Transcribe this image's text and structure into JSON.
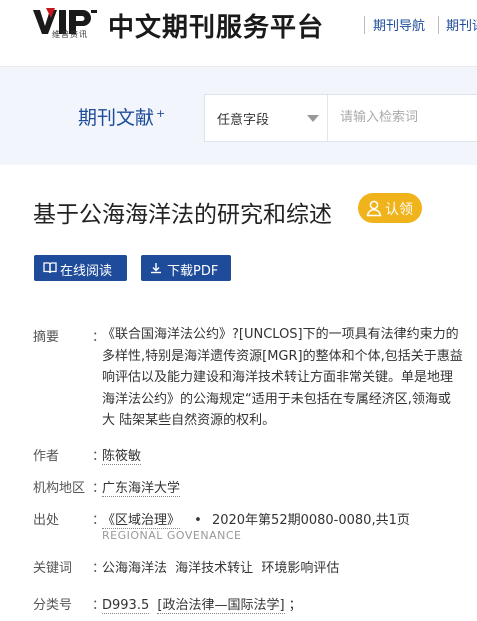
{
  "header": {
    "logo_text": "VIP",
    "logo_sub": "维普资讯",
    "site_title": "中文期刊服务平台",
    "nav": [
      "期刊导航",
      "期刊评价"
    ]
  },
  "search": {
    "label": "期刊文献",
    "label_sup": "+",
    "field_select": "任意字段",
    "placeholder": "请输入检索词"
  },
  "article": {
    "title": "基于公海海洋法的研究和综述",
    "claim_label": "认领",
    "read_online": "在线阅读",
    "download_pdf": "下载PDF"
  },
  "meta": {
    "abstract_label": "摘要",
    "abstract_lines": [
      "《联合国海洋法公约》?[UNCLOS]下的一项具有法律约束力的",
      "多样性,特别是海洋遗传资源[MGR]的整体和个体,包括关于惠益",
      "响评估以及能力建设和海洋技术转让方面非常关键。单是地理",
      "海洋法公约》的公海规定“适用于未包括在专属经济区,领海或",
      "大 陆架某些自然资源的权利。"
    ],
    "author_label": "作者",
    "author": "陈筱敏",
    "org_label": "机构地区",
    "org": "广东海洋大学",
    "source_label": "出处",
    "source_journal": "《区域治理》",
    "source_dot": "•",
    "source_detail": "2020年第52期0080-0080,共1页",
    "source_en": "REGIONAL GOVENANCE",
    "keywords_label": "关键词",
    "keywords": [
      "公海海洋法",
      "海洋技术转让",
      "环境影响评估"
    ],
    "class_label": "分类号",
    "class_code": "D993.5",
    "class_name": "[政治法律—国际法学]",
    "class_tail": "；"
  }
}
